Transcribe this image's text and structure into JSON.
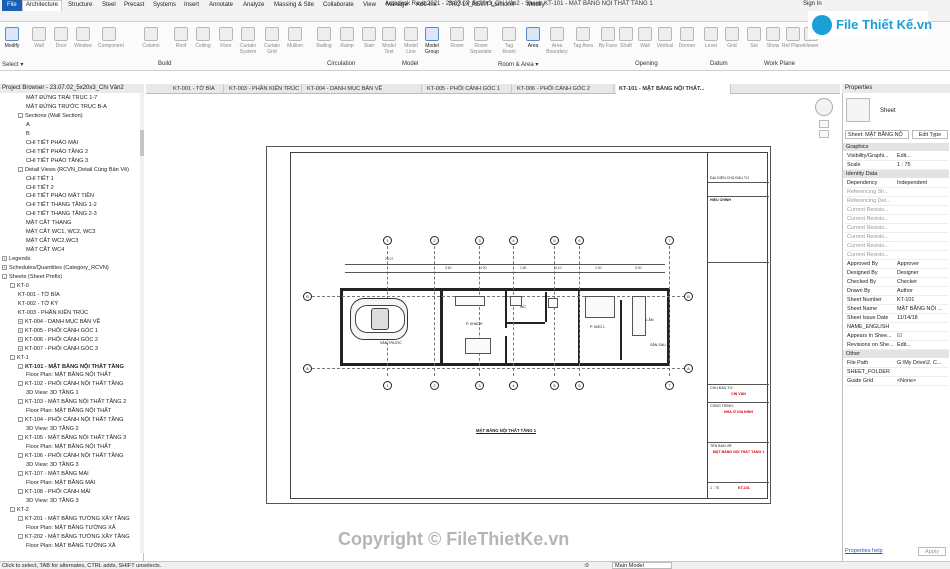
{
  "window": {
    "title": "Autodesk Revit 2021 - 23.07.02_5x20x3_Chi Vân2 - Sheet: KT-101 - MẶT BẰNG NỘI THẤT TẦNG 1",
    "signin": "Sign In"
  },
  "logo": {
    "text": "File Thiết Kế.vn"
  },
  "menu": [
    {
      "label": "File"
    },
    {
      "label": "Architecture"
    },
    {
      "label": "Structure"
    },
    {
      "label": "Steel"
    },
    {
      "label": "Precast"
    },
    {
      "label": "Systems"
    },
    {
      "label": "Insert"
    },
    {
      "label": "Annotate"
    },
    {
      "label": "Analyze"
    },
    {
      "label": "Massing & Site"
    },
    {
      "label": "Collaborate"
    },
    {
      "label": "View"
    },
    {
      "label": "Manage"
    },
    {
      "label": "Add-Ins"
    },
    {
      "label": "TRỢ LÝ REVIT"
    },
    {
      "label": "Lumion®"
    },
    {
      "label": "Modify"
    }
  ],
  "ribbon": {
    "buttons": [
      {
        "label": "Modify"
      },
      {
        "label": "Wall"
      },
      {
        "label": "Door"
      },
      {
        "label": "Window"
      },
      {
        "label": "Component"
      },
      {
        "label": "Column"
      },
      {
        "label": "Roof"
      },
      {
        "label": "Ceiling"
      },
      {
        "label": "Floor"
      },
      {
        "label": "Curtain System"
      },
      {
        "label": "Curtain Grid"
      },
      {
        "label": "Mullion"
      },
      {
        "label": "Railing"
      },
      {
        "label": "Ramp"
      },
      {
        "label": "Stair"
      },
      {
        "label": "Model Text"
      },
      {
        "label": "Model Line"
      },
      {
        "label": "Model Group"
      },
      {
        "label": "Room"
      },
      {
        "label": "Room Separator"
      },
      {
        "label": "Tag Room"
      },
      {
        "label": "Area"
      },
      {
        "label": "Area Boundary"
      },
      {
        "label": "Tag Area"
      },
      {
        "label": "By Face"
      },
      {
        "label": "Shaft"
      },
      {
        "label": "Wall"
      },
      {
        "label": "Vertical"
      },
      {
        "label": "Dormer"
      },
      {
        "label": "Level"
      },
      {
        "label": "Grid"
      },
      {
        "label": "Set"
      },
      {
        "label": "Show"
      },
      {
        "label": "Ref Plane"
      },
      {
        "label": "Viewer"
      }
    ],
    "panels": [
      {
        "label": "Select ▾"
      },
      {
        "label": "Build"
      },
      {
        "label": "Circulation"
      },
      {
        "label": "Model"
      },
      {
        "label": "Room & Area ▾"
      },
      {
        "label": "Opening"
      },
      {
        "label": "Datum"
      },
      {
        "label": "Work Plane"
      }
    ]
  },
  "browser": {
    "title": "Project Browser - 23.07.02_5x20x3_Chi Vân2",
    "rows": [
      {
        "label": "MẶT ĐỨNG TRÁI TRỤC 1-7",
        "indent": 3
      },
      {
        "label": "MẶT ĐỨNG TRƯỚC TRỤC B-A",
        "indent": 3
      },
      {
        "label": "Sections (Wall Section)",
        "indent": 2,
        "toggle": "-"
      },
      {
        "label": "A",
        "indent": 3
      },
      {
        "label": "B",
        "indent": 3
      },
      {
        "label": "CHI TIẾT PHÀO MÁI",
        "indent": 3
      },
      {
        "label": "CHI TIẾT PHÀO TẦNG 2",
        "indent": 3
      },
      {
        "label": "CHI TIẾT PHÀO TẦNG 3",
        "indent": 3
      },
      {
        "label": "Detail Views (RCVN_Detail Cùng Bản Vẽ)",
        "indent": 2,
        "toggle": "-"
      },
      {
        "label": "CHI TIẾT 1",
        "indent": 3
      },
      {
        "label": "CHI TIẾT 2",
        "indent": 3
      },
      {
        "label": "CHI TIẾT PHÀO MẶT TIỀN",
        "indent": 3
      },
      {
        "label": "CHI TIẾT THANG TẦNG 1-2",
        "indent": 3
      },
      {
        "label": "CHI TIẾT THANG TẦNG 2-3",
        "indent": 3
      },
      {
        "label": "MẶT CẮT THANG",
        "indent": 3
      },
      {
        "label": "MẶT CẮT WC1, WC2, WC3",
        "indent": 3
      },
      {
        "label": "MẶT CẮT WC2,WC3",
        "indent": 3
      },
      {
        "label": "MẶT CẮT WC4",
        "indent": 3
      },
      {
        "label": "Legends",
        "indent": 0,
        "toggle": "+"
      },
      {
        "label": "Schedules/Quantities (Category_RCVN)",
        "indent": 0,
        "toggle": "+"
      },
      {
        "label": "Sheets (Sheet Prefix)",
        "indent": 0,
        "toggle": "-"
      },
      {
        "label": "KT-0",
        "indent": 1,
        "toggle": "-"
      },
      {
        "label": "KT-001 - TỜ BÌA",
        "indent": 2
      },
      {
        "label": "KT-002 - TỜ KÝ",
        "indent": 2
      },
      {
        "label": "KT-003 - PHẦN KIẾN TRÚC",
        "indent": 2
      },
      {
        "label": "KT-004 - DANH MỤC BẢN VẼ",
        "indent": 2,
        "toggle": "+"
      },
      {
        "label": "KT-005 - PHỐI CẢNH GÓC 1",
        "indent": 2,
        "toggle": "+"
      },
      {
        "label": "KT-006 - PHỐI CẢNH GÓC 2",
        "indent": 2,
        "toggle": "+"
      },
      {
        "label": "KT-007 - PHỐI CẢNH GÓC 3",
        "indent": 2,
        "toggle": "+"
      },
      {
        "label": "KT-1",
        "indent": 1,
        "toggle": "-"
      },
      {
        "label": "KT-101 - MẶT BẰNG NỘI THẤT TẦNG",
        "indent": 2,
        "toggle": "-",
        "selected": true
      },
      {
        "label": "Floor Plan: MẶT BẰNG NỘI THẤT",
        "indent": 3
      },
      {
        "label": "KT-102 - PHỐI CẢNH NỘI THẤT TẦNG",
        "indent": 2,
        "toggle": "-"
      },
      {
        "label": "3D View: 3D TẦNG 1",
        "indent": 3
      },
      {
        "label": "KT-103 - MẶT BẰNG NỘI THẤT TẦNG 2",
        "indent": 2,
        "toggle": "-"
      },
      {
        "label": "Floor Plan: MẶT BẰNG NỘI THẤT",
        "indent": 3
      },
      {
        "label": "KT-104 - PHỐI CẢNH NỘI THẤT TẦNG",
        "indent": 2,
        "toggle": "-"
      },
      {
        "label": "3D View: 3D TẦNG 2",
        "indent": 3
      },
      {
        "label": "KT-105 - MẶT BẰNG NỘI THẤT TẦNG 3",
        "indent": 2,
        "toggle": "-"
      },
      {
        "label": "Floor Plan: MẶT BẰNG NỘI THẤT",
        "indent": 3
      },
      {
        "label": "KT-106 - PHỐI CẢNH NỘI THẤT TẦNG",
        "indent": 2,
        "toggle": "-"
      },
      {
        "label": "3D View: 3D TẦNG 3",
        "indent": 3
      },
      {
        "label": "KT-107 - MẶT BẰNG MÁI",
        "indent": 2,
        "toggle": "-"
      },
      {
        "label": "Floor Plan: MẶT BẰNG MÁI",
        "indent": 3
      },
      {
        "label": "KT-108 - PHỐI CẢNH MÁI",
        "indent": 2,
        "toggle": "-"
      },
      {
        "label": "3D View: 3D TẦNG 3",
        "indent": 3
      },
      {
        "label": "KT-2",
        "indent": 1,
        "toggle": "-"
      },
      {
        "label": "KT-201 - MẶT BẰNG TƯỜNG XÂY TẦNG",
        "indent": 2,
        "toggle": "-"
      },
      {
        "label": "Floor Plan: MẶT BẰNG TƯỜNG XÂ",
        "indent": 3
      },
      {
        "label": "KT-202 - MẶT BẰNG TƯỜNG XÂY TẦNG",
        "indent": 2,
        "toggle": "-"
      },
      {
        "label": "Floor Plan: MẶT BẰNG TƯỜNG XÂ",
        "indent": 3
      }
    ]
  },
  "tabs": [
    {
      "label": "KT-001 - TỜ BÌA"
    },
    {
      "label": "KT-003 - PHẦN KIẾN TRÚC"
    },
    {
      "label": "KT-004 - DANH MỤC BẢN VẼ"
    },
    {
      "label": "KT-005 - PHỐI CẢNH GÓC 1"
    },
    {
      "label": "KT-006 - PHỐI CẢNH GÓC 2"
    },
    {
      "label": "KT-101 - MẶT BẰNG NỘI THẤT..."
    }
  ],
  "sheet": {
    "plan_title": "MẶT BẰNG NỘI THẤT TẦNG 1",
    "grid_cols": [
      "1",
      "2",
      "3",
      "4",
      "5",
      "6",
      "7"
    ],
    "grid_rows": [
      "B",
      "A"
    ],
    "rooms": [
      {
        "label": "SÂN TRƯỚC"
      },
      {
        "label": "P. KHÁCH"
      },
      {
        "label": "WC"
      },
      {
        "label": "P. NGỦ 1"
      },
      {
        "label": "P. BẾP & ĂN"
      },
      {
        "label": "SÂN SAU"
      }
    ],
    "dims_top": [
      "23.07",
      "3.60",
      "4.00",
      "1.80",
      "3.10",
      "2.00",
      "5.00"
    ],
    "titleblock": {
      "company": "ĐẠI DIỆN CHỦ ĐẦU TƯ",
      "approval": "HIỆU CHỈNH",
      "owner_label": "CHỦ ĐẦU TƯ:",
      "owner": "CHỊ VÂN",
      "project_label": "CÔNG TRÌNH:",
      "project": "NHÀ Ở GIA ĐÌNH",
      "sheet_label": "TÊN BẢN VẼ:",
      "sheet_name": "MẶT BẰNG NỘI THẤT TẦNG 1",
      "sheet_no": "KT-101",
      "scale": "1 : 75"
    }
  },
  "properties": {
    "title": "Properties",
    "type": "Sheet",
    "selector": "Sheet: MẶT BẰNG NỘ",
    "edit_type": "Edit Type",
    "groups": [
      {
        "name": "Graphics",
        "rows": [
          {
            "k": "Visibility/Graphi...",
            "v": "Edit..."
          },
          {
            "k": "Scale",
            "v": "1 : 75"
          }
        ]
      },
      {
        "name": "Identity Data",
        "rows": [
          {
            "k": "Dependency",
            "v": "Independent"
          },
          {
            "k": "Referencing Sh...",
            "v": ""
          },
          {
            "k": "Referencing Det...",
            "v": ""
          },
          {
            "k": "Current Revisio...",
            "v": ""
          },
          {
            "k": "Current Revisio...",
            "v": ""
          },
          {
            "k": "Current Revisio...",
            "v": ""
          },
          {
            "k": "Current Revisio...",
            "v": ""
          },
          {
            "k": "Current Revisio...",
            "v": ""
          },
          {
            "k": "Current Revisio...",
            "v": ""
          },
          {
            "k": "Approved By",
            "v": "Approver"
          },
          {
            "k": "Designed By",
            "v": "Designer"
          },
          {
            "k": "Checked By",
            "v": "Checker"
          },
          {
            "k": "Drawn By",
            "v": "Author"
          },
          {
            "k": "Sheet Number",
            "v": "KT-101"
          },
          {
            "k": "Sheet Name",
            "v": "MẶT BẰNG NỘI ..."
          },
          {
            "k": "Sheet Issue Date",
            "v": "11/14/18"
          },
          {
            "k": "NAME_ENGLISH",
            "v": ""
          },
          {
            "k": "Appears In Shee...",
            "v": "☑"
          },
          {
            "k": "Revisions on She...",
            "v": "Edit..."
          }
        ]
      },
      {
        "name": "Other",
        "rows": [
          {
            "k": "File Path",
            "v": "G:\\My Drive\\2. C..."
          },
          {
            "k": "SHEET_FOLDER",
            "v": ""
          },
          {
            "k": "Guide Grid",
            "v": "<None>"
          }
        ]
      }
    ],
    "help": "Properties help",
    "apply": "Apply"
  },
  "status": {
    "text": "Click to select, TAB for alternates, CTRL adds, SHIFT unselects.",
    "model": "Main Model",
    "zero": ":0"
  },
  "watermark": "Copyright © FileThietKe.vn",
  "colors": {
    "accent": "#1a5fb4",
    "logo": "#1a9fd6",
    "red": "#d00000"
  }
}
